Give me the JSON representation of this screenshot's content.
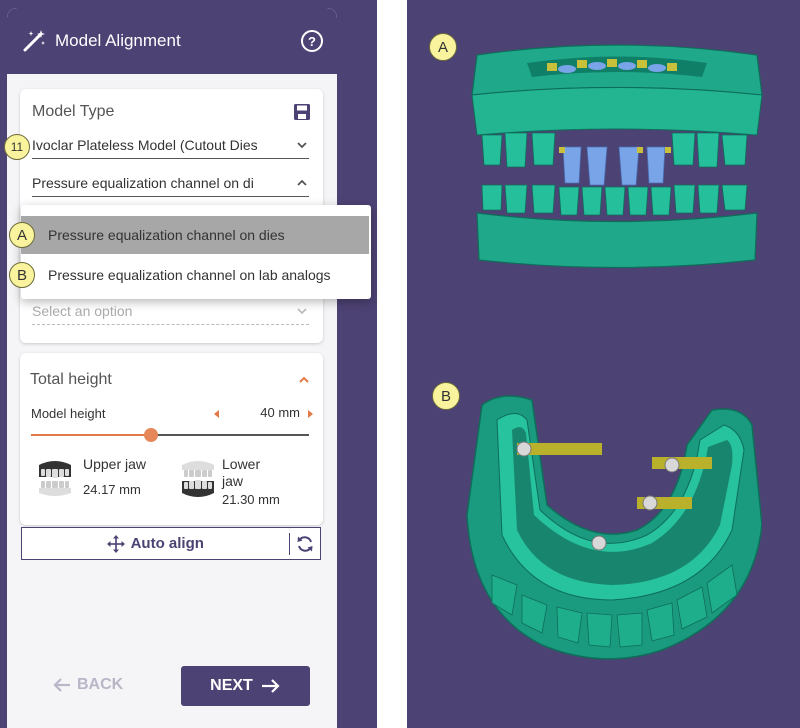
{
  "header": {
    "title": "Model Alignment",
    "icon": "magic-wand-icon",
    "help_icon": "help-icon"
  },
  "model_type": {
    "label": "Model Type",
    "save_icon": "save-icon",
    "select_1_value": "Ivoclar Plateless Model (Cutout Dies",
    "select_2_value": "Pressure equalization channel on di",
    "select_3_placeholder": "Select an option",
    "dropdown_options": [
      "Pressure equalization channel on dies",
      "Pressure equalization channel on lab analogs"
    ],
    "selected_option_index": 0
  },
  "badges": {
    "step": "11",
    "option_a": "A",
    "option_b": "B"
  },
  "total_height": {
    "label": "Total height",
    "model_height_label": "Model height",
    "model_height_value": "40 mm",
    "slider_fraction": 0.43,
    "upper_jaw_name": "Upper jaw",
    "upper_jaw_value": "24.17 mm",
    "lower_jaw_name": "Lower jaw",
    "lower_jaw_value": "21.30 mm"
  },
  "auto_align": {
    "label": "Auto align"
  },
  "nav": {
    "back_label": "BACK",
    "next_label": "NEXT"
  },
  "viewport": {
    "label_a": "A",
    "label_b": "B"
  },
  "colors": {
    "brand": "#4d4274",
    "accent": "#e27a47",
    "model": "#1fa88a",
    "die": "#7aa4e8",
    "analog": "#b9b12b",
    "badge": "#faf39d"
  }
}
